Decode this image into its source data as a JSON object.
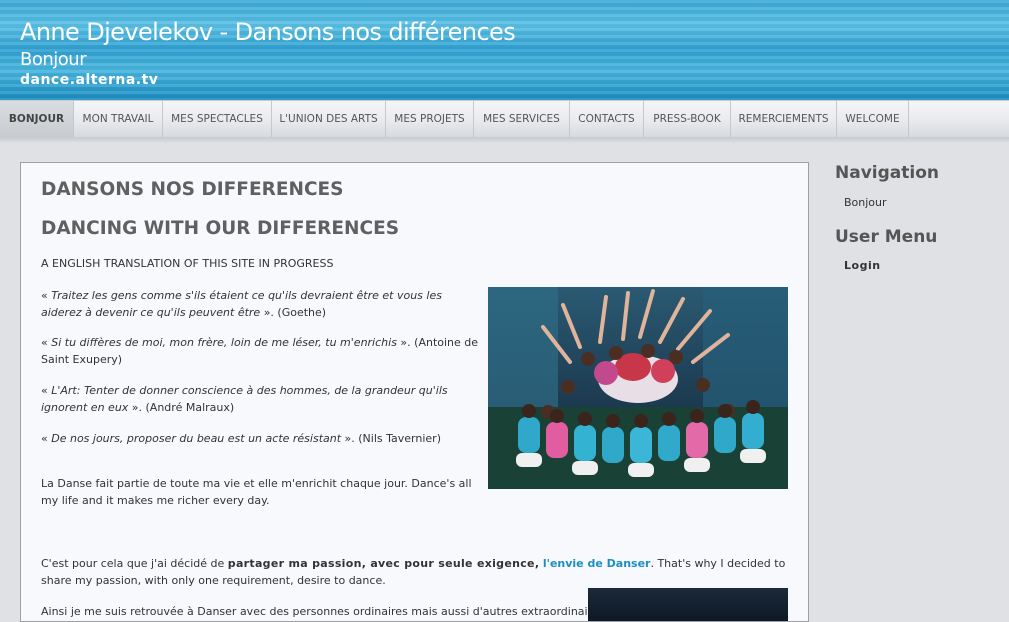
{
  "header": {
    "title": "Anne Djevelekov - Dansons nos différences",
    "subtitle": "Bonjour",
    "url": "dance.alterna.tv"
  },
  "nav": {
    "items": [
      {
        "label": "Bonjour",
        "active": true
      },
      {
        "label": "Mon travail",
        "active": false
      },
      {
        "label": "Mes spectacles",
        "active": false
      },
      {
        "label": "L'union des arts",
        "active": false
      },
      {
        "label": "Mes projets",
        "active": false
      },
      {
        "label": "Mes services",
        "active": false
      },
      {
        "label": "Contacts",
        "active": false
      },
      {
        "label": "Press-book",
        "active": false
      },
      {
        "label": "Remerciements",
        "active": false
      },
      {
        "label": "Welcome",
        "active": false
      }
    ]
  },
  "main": {
    "heading1": "DANSONS NOS DIFFERENCES",
    "heading2": "DANCING WITH OUR DIFFERENCES",
    "translation_note": "A ENGLISH TRANSLATION OF THIS SITE IN PROGRESS",
    "quotes": [
      {
        "open": "« ",
        "text": "Traitez les gens comme s'ils étaient ce qu'ils devraient être et vous les aiderez à devenir ce qu'ils peuvent être",
        "close": " ». (Goethe)"
      },
      {
        "open": "« ",
        "text": "Si tu diffères de moi, mon frère, loin de me léser, tu m'enrichis",
        "close": " ». (Antoine de Saint Exupery)"
      },
      {
        "open": "« ",
        "text": "L'Art: Tenter de donner conscience à des hommes, de la grandeur qu'ils ignorent en eux",
        "close": " ». (André Malraux)"
      },
      {
        "open": "« ",
        "text": "De nos jours, proposer du beau est un acte résistant",
        "close": " ». (Nils Tavernier)"
      }
    ],
    "dance_paragraph": "La Danse fait partie de toute ma vie et elle m'enrichit chaque jour. Dance's all my life and it makes me richer every day.",
    "passion": {
      "prefix": "C'est pour cela que j'ai décidé de ",
      "strong": "partager ma passion, avec pour seule exigence,",
      "link": "l'envie de Danser",
      "suffix": ". That's why I decided to share my passion, with only one requirement, desire to dance."
    },
    "last_paragraph": "Ainsi je me suis retrouvée à Danser avec des personnes ordinaires mais aussi d'autres extraordinaires"
  },
  "sidebar": {
    "navigation_title": "Navigation",
    "navigation_items": [
      "Bonjour"
    ],
    "user_menu_title": "User Menu",
    "user_menu_items": [
      "Login"
    ]
  },
  "colors": {
    "header_blue": "#2fa0d0",
    "link": "#1d8ec2",
    "heading_gray": "#606060"
  }
}
